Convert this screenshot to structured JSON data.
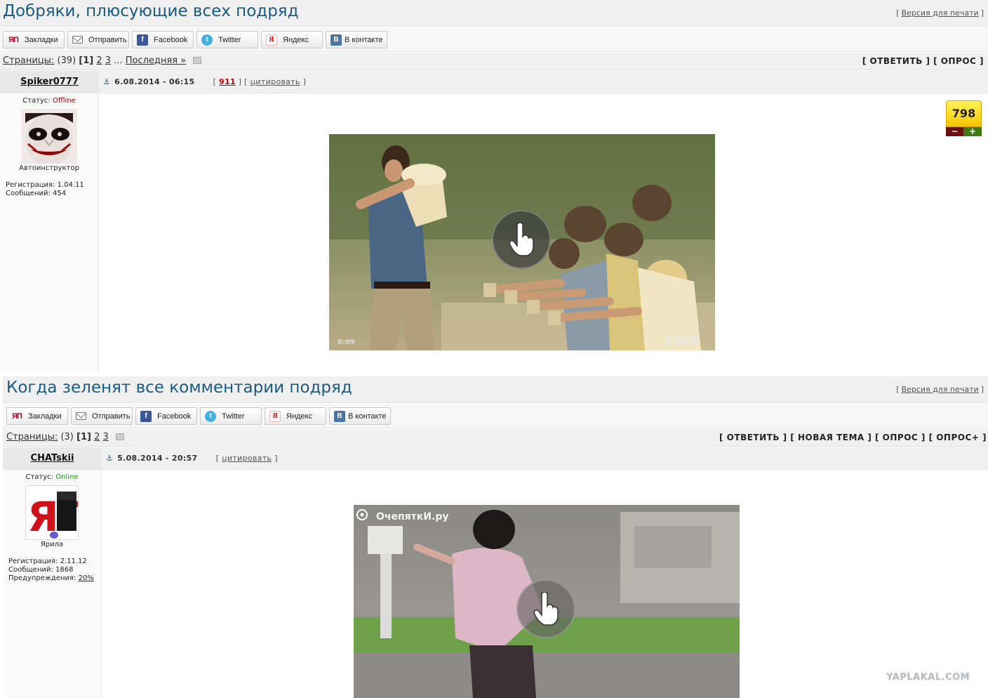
{
  "topics": [
    {
      "title": "Добряки, плюсующие всех подряд",
      "print_label": "Версия для печати",
      "share": [
        "Закладки",
        "Отправить",
        "Facebook",
        "Twitter",
        "Яндекс",
        "В контакте"
      ],
      "pages_label": "Страницы:",
      "pages_count": "(39)",
      "page_current": "[1]",
      "page_2": "2",
      "page_3": "3",
      "ellipsis": "...",
      "last_label": "Последняя »",
      "actions": "[ ОТВЕТИТЬ ] [ ОПРОС ]",
      "author": "Spiker0777",
      "date": "6.08.2014 - 06:15",
      "post_number": "911",
      "quote_label": "цитировать",
      "status_label": "Статус:",
      "status_value": "Offline",
      "rank": "Автоинструктор",
      "reg": "Регистрация: 1.04.11",
      "msgs": "Сообщений: 454",
      "rating": "798",
      "rating_minus": "−",
      "rating_plus": "+",
      "video_time": "0:09",
      "video_brand": "COUB"
    },
    {
      "title": "Когда зеленят все комментарии подряд",
      "print_label": "Версия для печати",
      "share": [
        "Закладки",
        "Отправить",
        "Facebook",
        "Twitter",
        "Яндекс",
        "В контакте"
      ],
      "pages_label": "Страницы:",
      "pages_count": "(3)",
      "page_current": "[1]",
      "page_2": "2",
      "page_3": "3",
      "actions": "[ ОТВЕТИТЬ ] [ НОВАЯ ТЕМА ] [ ОПРОС ] [ ОПРОС+ ]",
      "author": "CHATskii",
      "date": "5.08.2014 - 20:57",
      "quote_label": "цитировать",
      "status_label": "Статус:",
      "status_value": "Online",
      "avatar_text": "ЯП",
      "rank": "Ярила",
      "reg": "Регистрация: 2.11.12",
      "msgs": "Сообщений: 1868",
      "warn_label": "Предупреждения:",
      "warn_value": "20%",
      "video_watermark": "ОчепяткИ.ру"
    }
  ],
  "site_watermark": "YAPLAKAL.COM",
  "icons": [
    "yp-icon",
    "mail-icon",
    "facebook-icon",
    "twitter-icon",
    "yandex-icon",
    "vk-icon",
    "anchor-icon",
    "hand-pointer-icon"
  ]
}
